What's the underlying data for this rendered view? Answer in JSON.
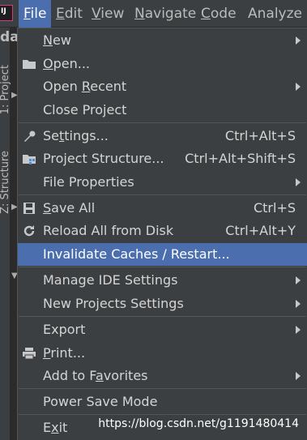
{
  "menubar": {
    "app_icon_text": "IJ",
    "menus": [
      {
        "label": "File",
        "mnemonic": "F",
        "rest": "ile"
      },
      {
        "label": "Edit",
        "mnemonic": "E",
        "rest": "dit"
      },
      {
        "label": "View",
        "mnemonic": "V",
        "rest": "iew"
      },
      {
        "label": "Navigate",
        "mnemonic": "N",
        "rest": "avigate"
      },
      {
        "label": "Code",
        "mnemonic": "C",
        "rest": "ode"
      },
      {
        "label": "Analyze",
        "mnemonic": "",
        "rest": "Analyze"
      }
    ]
  },
  "background": {
    "project_title_fragment": "da",
    "side_tab_project": "1: Project",
    "side_tab_structure": "Z: Structure"
  },
  "file_menu": {
    "items": [
      {
        "label": "New",
        "shortcut": "",
        "has_submenu": true,
        "icon": ""
      },
      {
        "label": "Open...",
        "shortcut": "",
        "has_submenu": false,
        "icon": "folder-icon"
      },
      {
        "label": "Open Recent",
        "shortcut": "",
        "has_submenu": true,
        "icon": ""
      },
      {
        "label": "Close Project",
        "shortcut": "",
        "has_submenu": false,
        "icon": ""
      },
      {
        "label": "Settings...",
        "shortcut": "Ctrl+Alt+S",
        "has_submenu": false,
        "icon": "wrench-icon"
      },
      {
        "label": "Project Structure...",
        "shortcut": "Ctrl+Alt+Shift+S",
        "has_submenu": false,
        "icon": "project-structure-icon"
      },
      {
        "label": "File Properties",
        "shortcut": "",
        "has_submenu": true,
        "icon": ""
      },
      {
        "label": "Save All",
        "shortcut": "Ctrl+S",
        "has_submenu": false,
        "icon": "save-icon"
      },
      {
        "label": "Reload All from Disk",
        "shortcut": "Ctrl+Alt+Y",
        "has_submenu": false,
        "icon": "reload-icon"
      },
      {
        "label": "Invalidate Caches / Restart...",
        "shortcut": "",
        "has_submenu": false,
        "icon": ""
      },
      {
        "label": "Manage IDE Settings",
        "shortcut": "",
        "has_submenu": true,
        "icon": ""
      },
      {
        "label": "New Projects Settings",
        "shortcut": "",
        "has_submenu": true,
        "icon": ""
      },
      {
        "label": "Export",
        "shortcut": "",
        "has_submenu": true,
        "icon": ""
      },
      {
        "label": "Print...",
        "shortcut": "",
        "has_submenu": false,
        "icon": "print-icon"
      },
      {
        "label": "Add to Favorites",
        "shortcut": "",
        "has_submenu": true,
        "icon": ""
      },
      {
        "label": "Power Save Mode",
        "shortcut": "",
        "has_submenu": false,
        "icon": ""
      },
      {
        "label": "Exit",
        "shortcut": "",
        "has_submenu": false,
        "icon": ""
      }
    ],
    "selected_item": "Invalidate Caches / Restart..."
  },
  "watermark": "https://blog.csdn.net/g1191480414",
  "colors": {
    "menubar_bg": "#3c3f41",
    "selection": "#4b6eaf",
    "text": "#d4d4d4"
  }
}
